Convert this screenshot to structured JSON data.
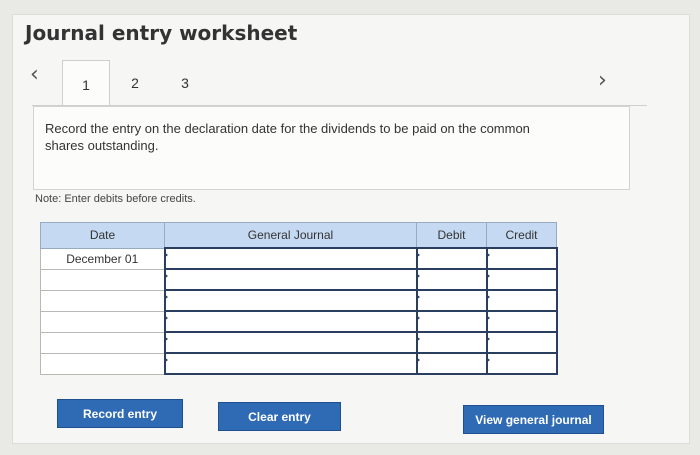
{
  "title": "Journal entry worksheet",
  "nav": {
    "prev_icon": "‹",
    "next_icon": "›"
  },
  "tabs": [
    {
      "label": "1",
      "active": true
    },
    {
      "label": "2"
    },
    {
      "label": "3"
    }
  ],
  "instruction": "Record the entry on the declaration date for the dividends to be paid on the common shares outstanding.",
  "note": "Note: Enter debits before credits.",
  "table": {
    "headers": {
      "date": "Date",
      "journal": "General Journal",
      "debit": "Debit",
      "credit": "Credit"
    },
    "rows": [
      {
        "date": "December 01"
      },
      {
        "date": ""
      },
      {
        "date": ""
      },
      {
        "date": ""
      },
      {
        "date": ""
      },
      {
        "date": ""
      }
    ]
  },
  "buttons": {
    "record": "Record entry",
    "clear": "Clear entry",
    "view": "View general journal"
  }
}
